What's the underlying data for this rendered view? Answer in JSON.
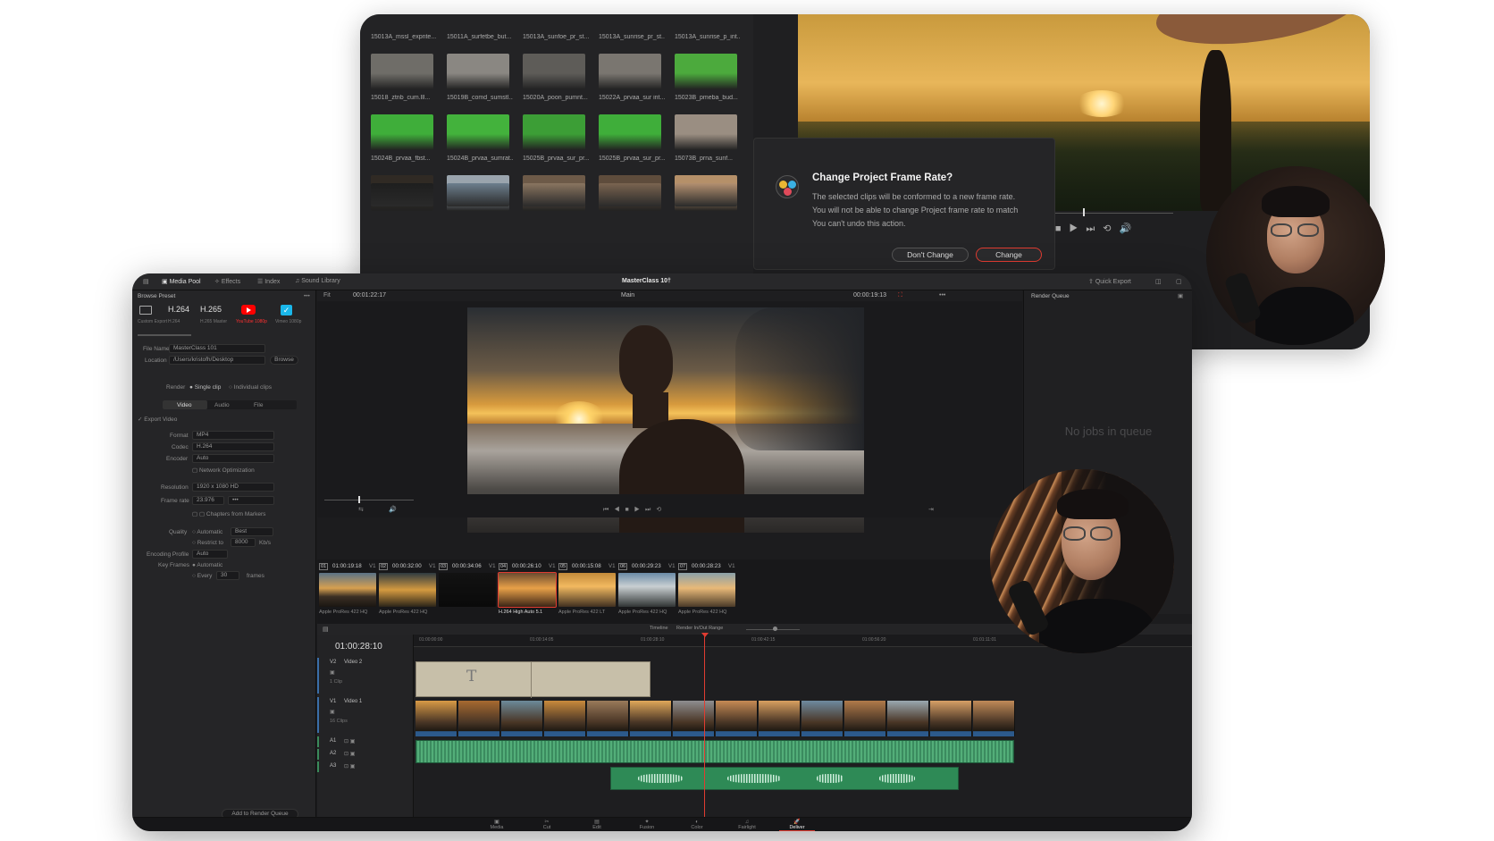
{
  "back_window": {
    "pool_row1_labels": [
      "15013A_mssl_expnte...",
      "15011A_surfetbe_but...",
      "15013A_sunfoe_pr_st...",
      "15013A_sunrise_pr_st...",
      "15013A_sunrise_p_int..."
    ],
    "pool_row2_labels": [
      "15018_ztnb_cum.lll...",
      "15019B_comd_sumstl...",
      "15020A_poon_pumnt...",
      "15022A_prvaa_sur int...",
      "15023B_pmeba_bud..."
    ],
    "pool_row3_labels": [
      "15024B_prvaa_fbst...",
      "15024B_prvaa_sumrat...",
      "15025B_prvaa_sur_pr...",
      "15025B_prvaa_sur_pr...",
      "15073B_prna_sunf..."
    ]
  },
  "dialog": {
    "title": "Change Project Frame Rate?",
    "body": "The selected clips will be conformed to a new frame rate. You will not be able to change Project frame rate to match You can't undo this action.",
    "dont_change_label": "Don't Change",
    "change_label": "Change"
  },
  "topbar": {
    "media_pool": "Media Pool",
    "effects": "Effects",
    "index": "Index",
    "sound_library": "Sound Library",
    "project_title": "MasterClass 10†",
    "quick_export": "Quick Export"
  },
  "render_settings": {
    "panel_title": "Browse Preset",
    "presets": [
      {
        "label": "",
        "sub": "Custom Export"
      },
      {
        "label": "H.264",
        "sub": "H.264"
      },
      {
        "label": "H.265",
        "sub": "H.265 Master"
      },
      {
        "label": "",
        "sub": "YouTube 1080p"
      },
      {
        "label": "",
        "sub": "Vimeo 1080p"
      }
    ],
    "file_name_label": "File Name",
    "file_name_value": "MasterClass 101",
    "location_label": "Location",
    "location_value": "/Users/kristofh/Desktop",
    "browse_label": "Browse",
    "render_label": "Render",
    "single_clip": "Single clip",
    "individual_clips": "Individual clips",
    "tabs": [
      "Video",
      "Audio",
      "File"
    ],
    "export_video": "Export Video",
    "format_label": "Format",
    "format_value": "MP4",
    "codec_label": "Codec",
    "codec_value": "H.264",
    "encoder_label": "Encoder",
    "encoder_value": "Auto",
    "network_opt": "Network Optimization",
    "resolution_label": "Resolution",
    "resolution_value": "1920 x 1080 HD",
    "framerate_label": "Frame rate",
    "framerate_value": "23.976",
    "framerate_extra": "•••",
    "chapters": "Chapters from Markers",
    "quality_label": "Quality",
    "quality_auto": "Automatic",
    "quality_value": "Best",
    "restrict_label": "Restrict to",
    "restrict_value": "8000",
    "restrict_unit": "Kb/s",
    "enc_profile_label": "Encoding Profile",
    "enc_profile_value": "Auto",
    "keyframes_label": "Key Frames",
    "keyframes_auto": "Automatic",
    "every_label": "Every",
    "every_value": "30",
    "frames_label": "frames",
    "add_queue": "Add to Render Queue"
  },
  "viewer": {
    "fit": "Fit",
    "timecode": "00:01:22:17",
    "main_label": "Main",
    "right_tc": "00:00:19:13"
  },
  "render_queue": {
    "title": "Render Queue",
    "empty": "No jobs in queue"
  },
  "clips": [
    {
      "num": "01",
      "tc": "01:00:19:18",
      "track": "V1",
      "name": "Apple ProRes 422 HQ"
    },
    {
      "num": "02",
      "tc": "00:00:32:00",
      "track": "V1",
      "name": "Apple ProRes 422 HQ"
    },
    {
      "num": "03",
      "tc": "00:00:34:06",
      "track": "V1",
      "name": ""
    },
    {
      "num": "04",
      "tc": "00:00:26:10",
      "track": "V1",
      "name": "H.264 High Auto 5.1"
    },
    {
      "num": "05",
      "tc": "00:00:15:08",
      "track": "V1",
      "name": "Apple ProRes 422 LT"
    },
    {
      "num": "06",
      "tc": "00:00:29:23",
      "track": "V1",
      "name": "Apple ProRes 422 HQ"
    },
    {
      "num": "07",
      "tc": "00:00:28:23",
      "track": "V1",
      "name": "Apple ProRes 422 HQ"
    }
  ],
  "timeline": {
    "timecode": "01:00:28:10",
    "ruler": [
      "01:00:00:00",
      "01:00:14:05",
      "01:00:28:10",
      "01:00:42:15",
      "01:00:56:20",
      "01:01:11:01",
      "01:01:25:06"
    ],
    "tracks": [
      {
        "id": "V2",
        "name": "Video 2",
        "count": "1 Clip"
      },
      {
        "id": "V1",
        "name": "Video 1",
        "count": "16 Clips"
      },
      {
        "id": "A1",
        "name": "",
        "count": ""
      },
      {
        "id": "A2",
        "name": "",
        "count": ""
      },
      {
        "id": "A3",
        "name": "",
        "count": ""
      }
    ],
    "title_clip": "T",
    "head_options": "Timeline",
    "head_render": "Render  In/Out Range"
  },
  "pages": [
    "Media",
    "Cut",
    "Edit",
    "Fusion",
    "Color",
    "Fairlight",
    "Deliver"
  ],
  "colors": {
    "accent_red": "#e03c31",
    "youtube": "#ff0000",
    "vimeo": "#1ab7ea",
    "green_screen": "#3fae3a",
    "audio_green": "#3a8a5a"
  }
}
